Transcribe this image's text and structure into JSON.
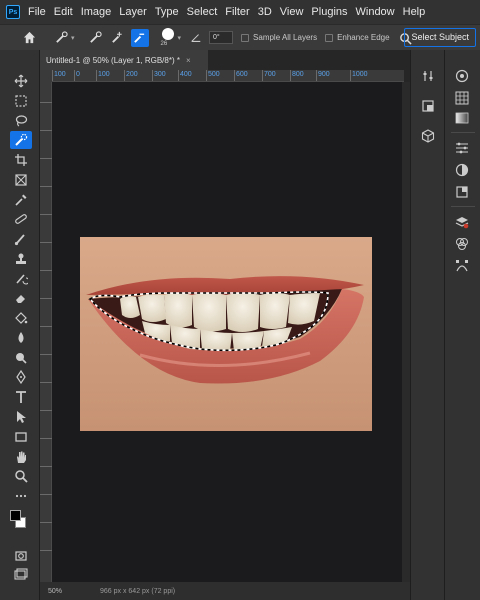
{
  "menu": [
    "File",
    "Edit",
    "Image",
    "Layer",
    "Type",
    "Select",
    "Filter",
    "3D",
    "View",
    "Plugins",
    "Window",
    "Help"
  ],
  "app_badge": "Ps",
  "options": {
    "brush_size": "26",
    "angle_value": "0°",
    "sample_all_layers": "Sample All Layers",
    "enhance_edge": "Enhance Edge",
    "select_subject": "Select Subject"
  },
  "document": {
    "tab_title": "Untitled-1 @ 50% (Layer 1, RGB/8*) *",
    "close": "×"
  },
  "ruler_labels": [
    "100",
    "0",
    "100",
    "200",
    "300",
    "400",
    "500",
    "600",
    "700",
    "800",
    "900",
    "1000"
  ],
  "status": {
    "zoom": "50%",
    "doc_info": "966 px x 642 px (72 ppi)"
  },
  "colors": {
    "accent": "#1473e6",
    "menubar": "#323232",
    "canvas_bg": "#1b1b1e"
  }
}
